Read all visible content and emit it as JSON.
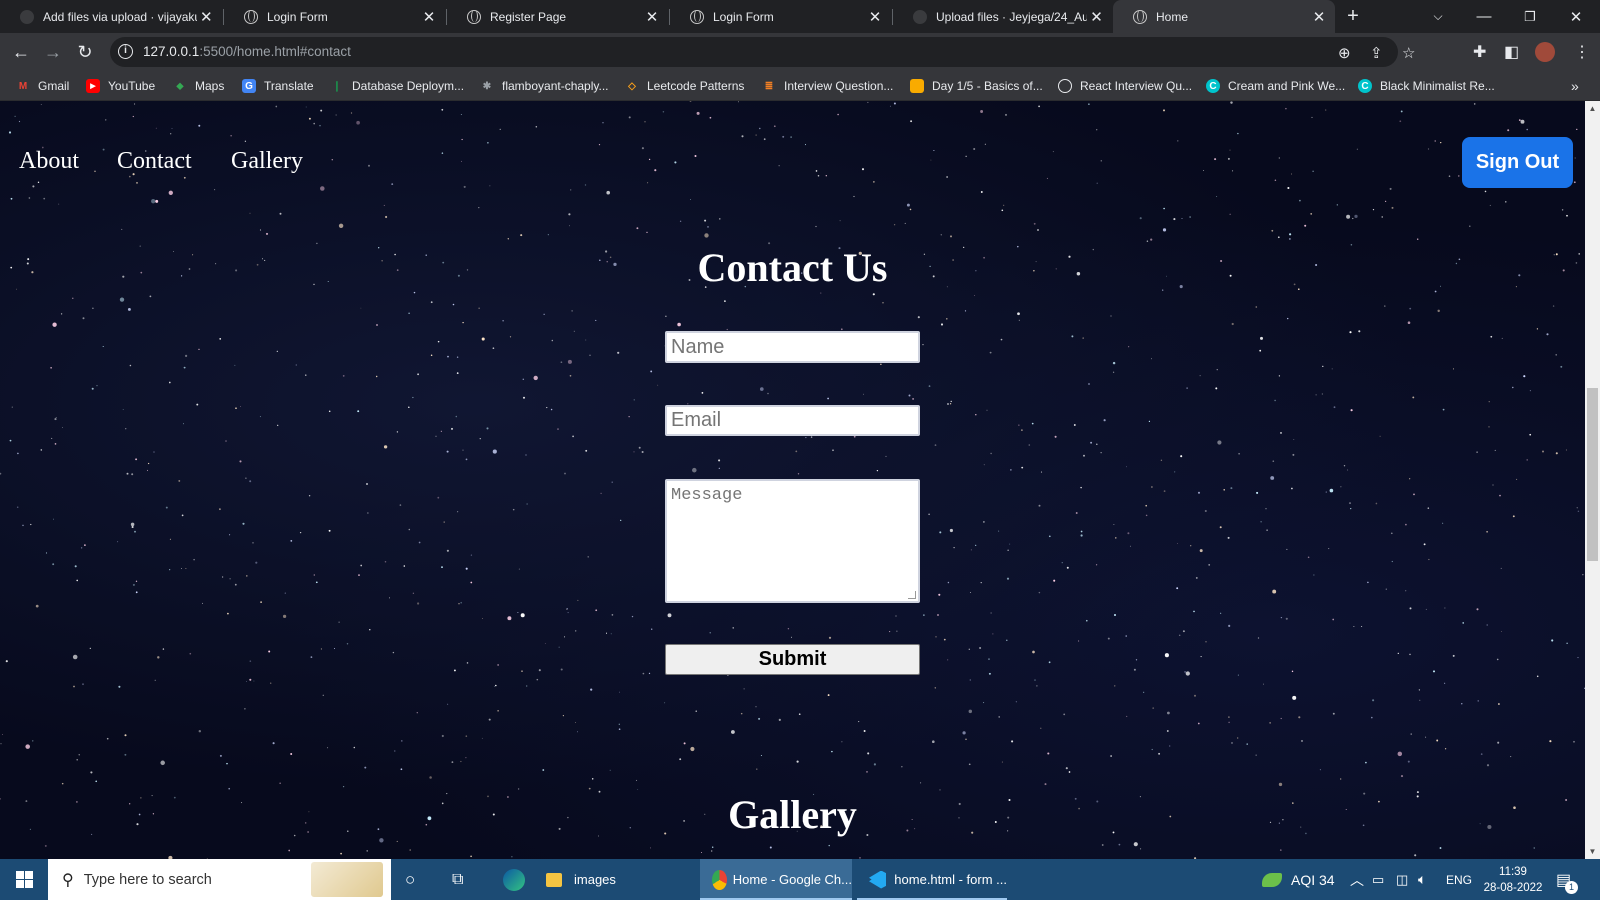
{
  "browser": {
    "tabs": [
      {
        "title": "Add files via upload · vijayaku",
        "icon": "github-icon",
        "active": false
      },
      {
        "title": "Login Form",
        "icon": "globe-icon",
        "active": false
      },
      {
        "title": "Register Page",
        "icon": "globe-icon",
        "active": false
      },
      {
        "title": "Login Form",
        "icon": "globe-icon",
        "active": false
      },
      {
        "title": "Upload files · Jeyjega/24_Aug",
        "icon": "github-icon",
        "active": false
      },
      {
        "title": "Home",
        "icon": "globe-icon",
        "active": true
      }
    ],
    "new_tab_label": "+",
    "url_host": "127.0.0.1",
    "url_rest": ":5500/home.html#contact",
    "bookmarks": [
      {
        "label": "Gmail",
        "icon": "gmail-icon",
        "color": "#ea4335"
      },
      {
        "label": "YouTube",
        "icon": "youtube-icon",
        "color": "#ff0000"
      },
      {
        "label": "Maps",
        "icon": "maps-icon",
        "color": "#34a853"
      },
      {
        "label": "Translate",
        "icon": "translate-icon",
        "color": "#4285f4"
      },
      {
        "label": "Database Deploym...",
        "icon": "leaf-icon",
        "color": "#13aa52"
      },
      {
        "label": "flamboyant-chaply...",
        "icon": "sparkle-icon",
        "color": "#9aa0a6"
      },
      {
        "label": "Leetcode Patterns",
        "icon": "leetcode-icon",
        "color": "#f89f1b"
      },
      {
        "label": "Interview Question...",
        "icon": "stack-icon",
        "color": "#f48024"
      },
      {
        "label": "Day 1/5 - Basics of...",
        "icon": "folder-icon",
        "color": "#f9ab00"
      },
      {
        "label": "React Interview Qu...",
        "icon": "globe-icon",
        "color": "#e8eaed"
      },
      {
        "label": "Cream and Pink We...",
        "icon": "canva-icon",
        "color": "#00c4cc"
      },
      {
        "label": "Black Minimalist Re...",
        "icon": "canva-icon",
        "color": "#00c4cc"
      }
    ]
  },
  "page": {
    "nav": {
      "about": "About",
      "contact": "Contact",
      "gallery": "Gallery"
    },
    "signout_label": "Sign Out",
    "contact_heading": "Contact Us",
    "form": {
      "name_placeholder": "Name",
      "email_placeholder": "Email",
      "message_placeholder": "Message",
      "submit_label": "Submit"
    },
    "gallery_heading": "Gallery",
    "background": "starfield"
  },
  "taskbar": {
    "search_placeholder": "Type here to search",
    "items": [
      {
        "label": "images",
        "icon": "folder-icon"
      },
      {
        "label": "Home - Google Ch...",
        "icon": "chrome-icon",
        "active": true
      },
      {
        "label": "home.html - form ...",
        "icon": "vscode-icon"
      }
    ],
    "aqi": "AQI 34",
    "language": "ENG",
    "time": "11:39",
    "date": "28-08-2022",
    "notification_count": "1"
  },
  "colors": {
    "accent_button": "#1a73e8",
    "taskbar": "#1c4b74",
    "page_bg": "#070a1d"
  }
}
